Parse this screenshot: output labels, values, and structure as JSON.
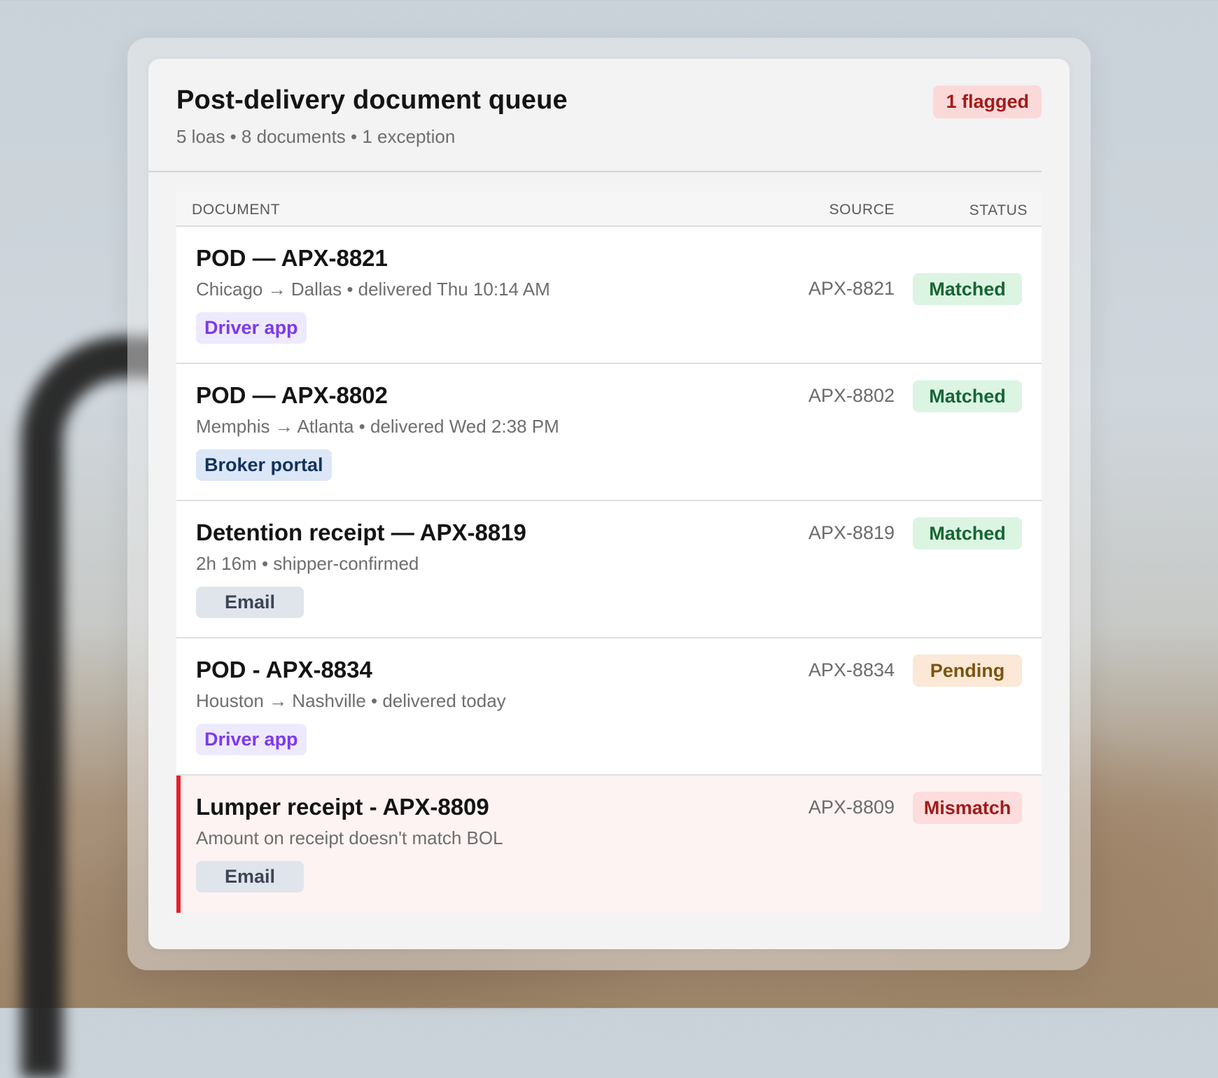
{
  "queue": {
    "title": "Post-delivery document queue",
    "subtitle": "5 loas • 8 documents • 1 exception",
    "flag_badge": "1 flagged"
  },
  "table": {
    "columns": {
      "document": "DOCUMENT",
      "source": "SOURCE",
      "status": "STATUS"
    },
    "rows": [
      {
        "title": "POD — APX-8821",
        "meta": "Chicago → Dallas • delivered Thu 10:14 AM",
        "tag": "Driver app",
        "source_id": "APX-8821",
        "status": "Matched"
      },
      {
        "title": "POD — APX-8802",
        "meta": "Memphis → Atlanta • delivered Wed 2:38 PM",
        "tag": "Broker portal",
        "source_id": "APX-8802",
        "status": "Matched"
      },
      {
        "title": "Detention receipt — APX-8819",
        "meta": "2h 16m • shipper-confirmed",
        "tag": "Email",
        "source_id": "APX-8819",
        "status": "Matched"
      },
      {
        "title": "POD - APX-8834",
        "meta": "Houston → Nashville • delivered today",
        "tag": "Driver app",
        "source_id": "APX-8834",
        "status": "Pending"
      },
      {
        "title": "Lumper receipt - APX-8809",
        "meta": "Amount on receipt doesn't match BOL",
        "tag": "Email",
        "source_id": "APX-8809",
        "status": "Mismatch"
      }
    ]
  },
  "colors": {
    "matched": "#166534",
    "pending": "#7a5410",
    "mismatch": "#a11b1b",
    "flag_accent": "#e8202a",
    "driver_app": "#7c3aed"
  }
}
